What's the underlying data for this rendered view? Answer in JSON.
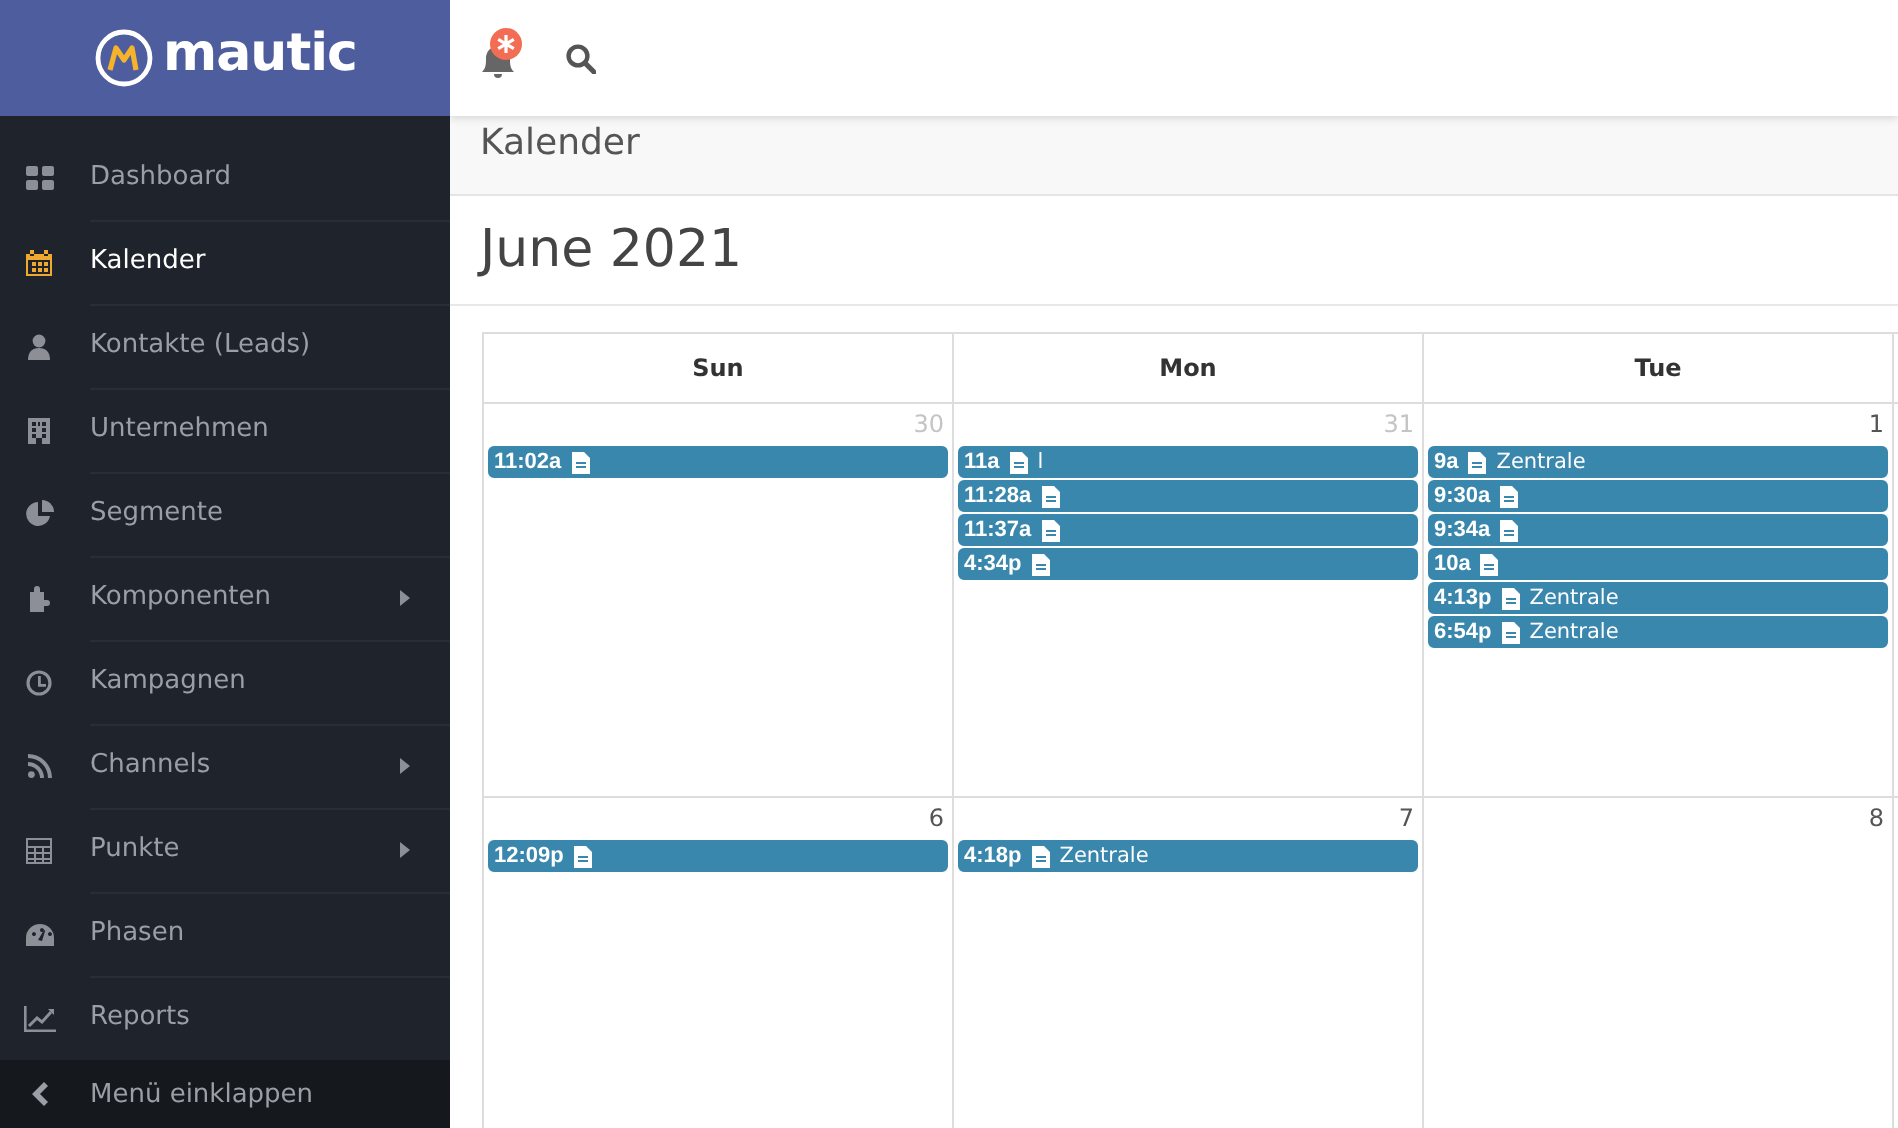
{
  "logo": {
    "text": "mautic"
  },
  "sidebar": {
    "items": [
      {
        "label": "Dashboard",
        "selected": false,
        "has_submenu": false
      },
      {
        "label": "Kalender",
        "selected": true,
        "has_submenu": false
      },
      {
        "label": "Kontakte (Leads)",
        "selected": false,
        "has_submenu": false
      },
      {
        "label": "Unternehmen",
        "selected": false,
        "has_submenu": false
      },
      {
        "label": "Segmente",
        "selected": false,
        "has_submenu": false
      },
      {
        "label": "Komponenten",
        "selected": false,
        "has_submenu": true
      },
      {
        "label": "Kampagnen",
        "selected": false,
        "has_submenu": false
      },
      {
        "label": "Channels",
        "selected": false,
        "has_submenu": true
      },
      {
        "label": "Punkte",
        "selected": false,
        "has_submenu": true
      },
      {
        "label": "Phasen",
        "selected": false,
        "has_submenu": false
      },
      {
        "label": "Reports",
        "selected": false,
        "has_submenu": false
      }
    ],
    "collapse_label": "Menü einklappen"
  },
  "breadcrumb": "Kalender",
  "title": "June 2021",
  "calendar": {
    "columns": [
      "Sun",
      "Mon",
      "Tue"
    ],
    "weeks": [
      {
        "days": [
          {
            "date": "30",
            "other_month": true,
            "events": [
              {
                "time": "11:02a"
              }
            ]
          },
          {
            "date": "31",
            "other_month": true,
            "events": [
              {
                "time": "11a",
                "title": "l"
              },
              {
                "time": "11:28a"
              },
              {
                "time": "11:37a"
              },
              {
                "time": "4:34p"
              }
            ]
          },
          {
            "date": "1",
            "other_month": false,
            "events": [
              {
                "time": "9a",
                "title": "Zentrale"
              },
              {
                "time": "9:30a"
              },
              {
                "time": "9:34a"
              },
              {
                "time": "10a"
              },
              {
                "time": "4:13p",
                "title": "Zentrale"
              },
              {
                "time": "6:54p",
                "title": "Zentrale"
              }
            ]
          }
        ]
      },
      {
        "days": [
          {
            "date": "6",
            "other_month": false,
            "events": [
              {
                "time": "12:09p"
              }
            ]
          },
          {
            "date": "7",
            "other_month": false,
            "events": [
              {
                "time": "4:18p",
                "title": "Zentrale"
              }
            ]
          },
          {
            "date": "8",
            "other_month": false
          }
        ]
      }
    ]
  }
}
